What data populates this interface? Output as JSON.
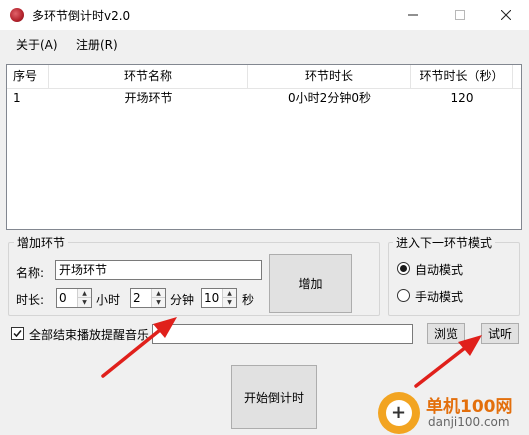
{
  "window": {
    "title": "多环节倒计时v2.0",
    "icon": "app-icon",
    "controls": {
      "minimize": "—",
      "maximize": "☐",
      "close": "✕"
    }
  },
  "menu": {
    "about": "关于(A)",
    "register": "注册(R)"
  },
  "list": {
    "columns": [
      "序号",
      "环节名称",
      "环节时长",
      "环节时长（秒）"
    ],
    "rows": [
      [
        "1",
        "开场环节",
        "0小时2分钟0秒",
        "120"
      ]
    ]
  },
  "add_section": {
    "title": "增加环节",
    "name_label": "名称:",
    "name_value": "开场环节",
    "duration_label": "时长:",
    "hours_value": "0",
    "hours_unit": "小时",
    "minutes_value": "2",
    "minutes_unit": "分钟",
    "seconds_value": "10",
    "seconds_unit": "秒",
    "add_button": "增加"
  },
  "mode_section": {
    "title": "进入下一环节模式",
    "auto_label": "自动模式",
    "manual_label": "手动模式",
    "selected": "auto"
  },
  "music": {
    "checkbox_label": "全部结束播放提醒音乐",
    "checked": true,
    "path_value": "",
    "browse_button": "浏览",
    "listen_button": "试听"
  },
  "start_button": "开始倒计时",
  "watermark": {
    "title": "单机100网",
    "url": "danji100.com"
  },
  "colors": {
    "annotation_arrow": "#e0201b",
    "watermark_orange": "#e36f0c"
  }
}
